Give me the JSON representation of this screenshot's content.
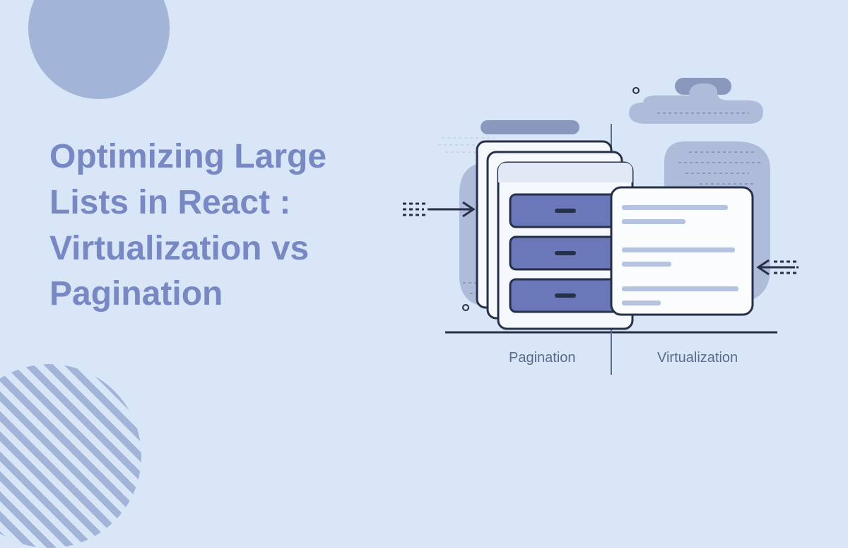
{
  "title": "Optimizing Large Lists in React : Virtualization vs Pagination",
  "labels": {
    "pagination": "Pagination",
    "virtualization": "Virtualization"
  },
  "colors": {
    "background": "#d9e6f7",
    "accent": "#7788c3",
    "decorShape": "#a2b5d8",
    "cardFill": "#6a77b8",
    "cardStroke": "#273049",
    "blobLight": "#aebbd9",
    "blobDark": "#8b98bd",
    "lineLight": "#b6c3e0"
  }
}
